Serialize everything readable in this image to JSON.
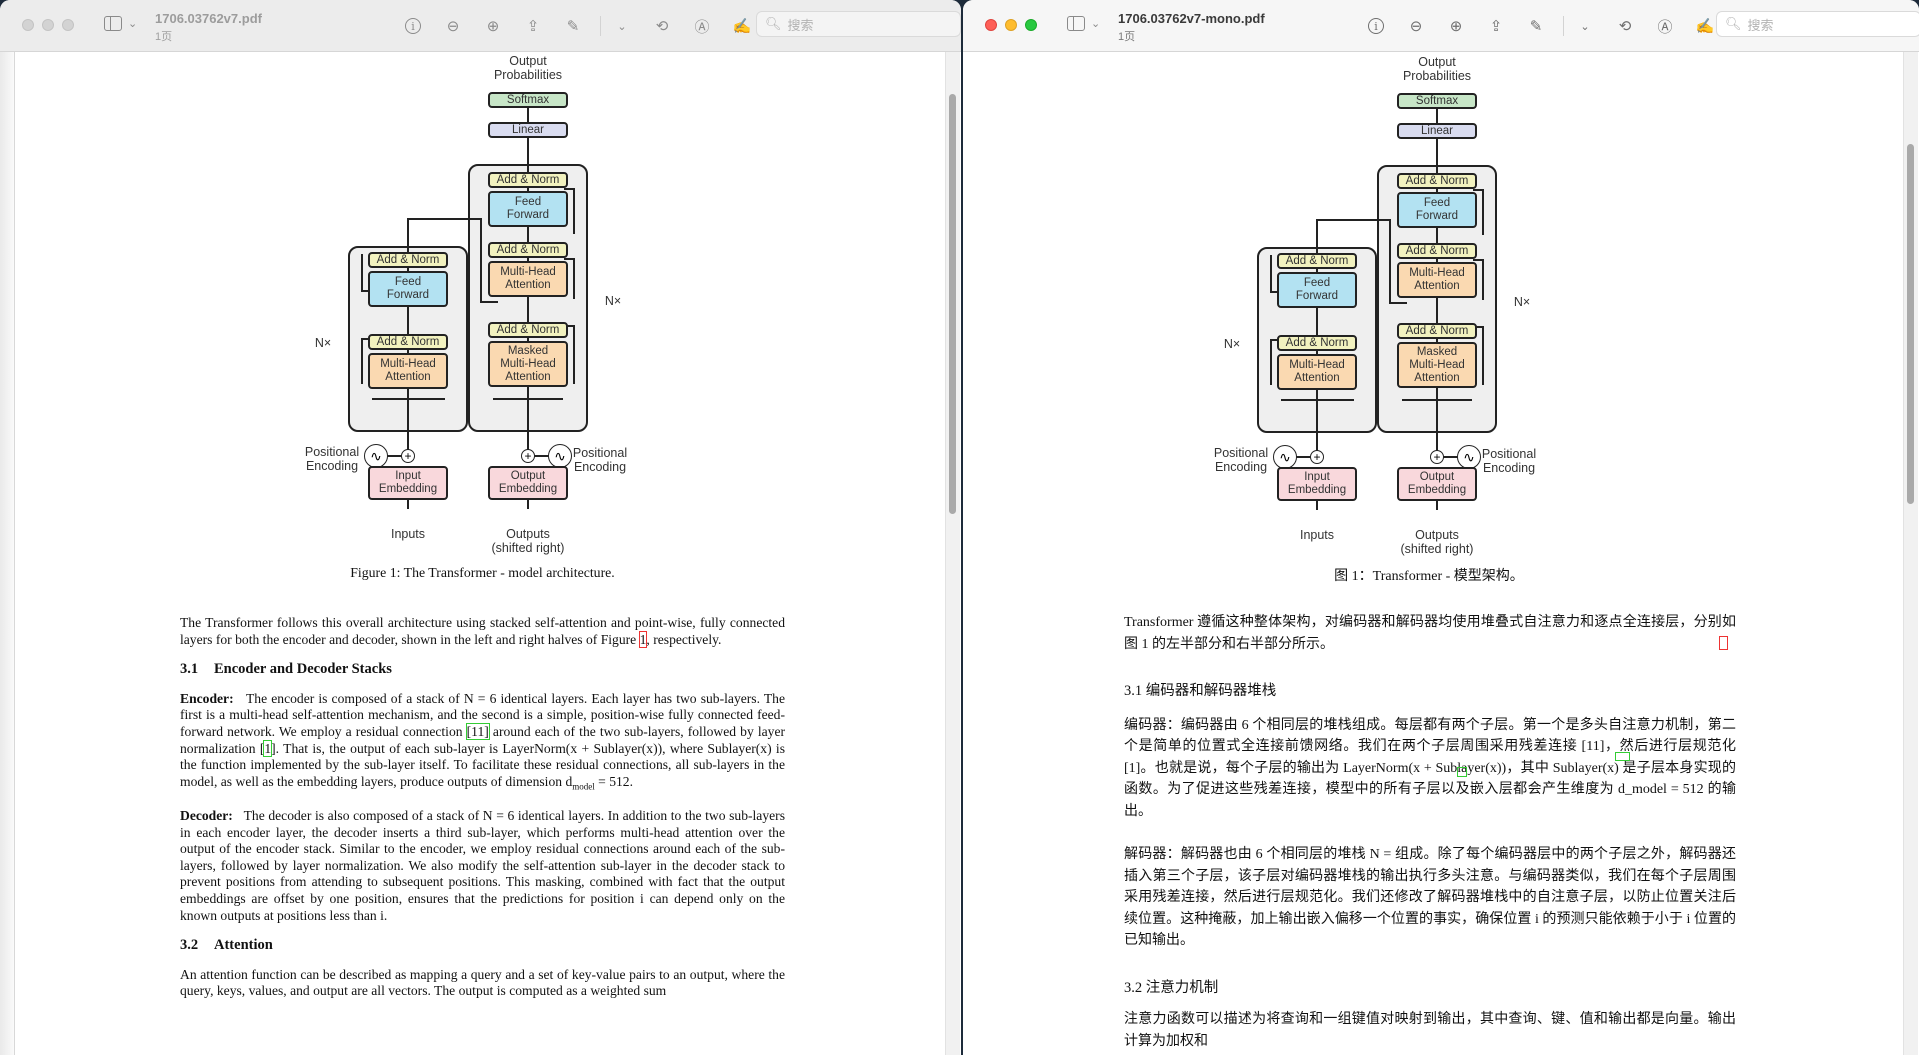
{
  "left_window": {
    "title": "1706.03762v7.pdf",
    "subtitle": "1页",
    "search_placeholder": "搜索",
    "diagram": {
      "output_label": "Output\nProbabilities",
      "softmax": "Softmax",
      "linear": "Linear",
      "add_norm": "Add & Norm",
      "feed_forward": "Feed\nForward",
      "multi_head": "Multi-Head\nAttention",
      "masked_multi_head": "Masked\nMulti-Head\nAttention",
      "nx": "N×",
      "pos_enc": "Positional\nEncoding",
      "input_emb": "Input\nEmbedding",
      "output_emb": "Output\nEmbedding",
      "inputs": "Inputs",
      "outputs": "Outputs\n(shifted right)"
    },
    "caption": "Figure 1: The Transformer - model architecture.",
    "intro": {
      "before": "The Transformer follows this overall architecture using stacked self-attention and point-wise, fully connected layers for both the encoder and decoder, shown in the left and right halves of Figure ",
      "ref": "1",
      "after": ", respectively."
    },
    "section_31": {
      "num": "3.1",
      "title": "Encoder and Decoder Stacks"
    },
    "encoder": {
      "label": "Encoder:",
      "p1": "The encoder is composed of a stack of N = 6 identical layers. Each layer has two sub-layers. The first is a multi-head self-attention mechanism, and the second is a simple, position-wise fully connected feed-forward network. We employ a residual connection ",
      "ref1": "[11]",
      "p2": " around each of the two sub-layers, followed by layer normalization [",
      "ref2": "1",
      "p3": "]. That is, the output of each sub-layer is LayerNorm(x + Sublayer(x)), where Sublayer(x) is the function implemented by the sub-layer itself. To facilitate these residual connections, all sub-layers in the model, as well as the embedding layers, produce outputs of dimension d",
      "sub": "model",
      "p4": " = 512."
    },
    "decoder": {
      "label": "Decoder:",
      "text": "The decoder is also composed of a stack of N = 6 identical layers. In addition to the two sub-layers in each encoder layer, the decoder inserts a third sub-layer, which performs multi-head attention over the output of the encoder stack. Similar to the encoder, we employ residual connections around each of the sub-layers, followed by layer normalization. We also modify the self-attention sub-layer in the decoder stack to prevent positions from attending to subsequent positions. This masking, combined with fact that the output embeddings are offset by one position, ensures that the predictions for position i can depend only on the known outputs at positions less than i."
    },
    "section_32": {
      "num": "3.2",
      "title": "Attention"
    },
    "attention": "An attention function can be described as mapping a query and a set of key-value pairs to an output, where the query, keys, values, and output are all vectors. The output is computed as a weighted sum"
  },
  "right_window": {
    "title": "1706.03762v7-mono.pdf",
    "subtitle": "1页",
    "search_placeholder": "搜索",
    "caption": "图 1：Transformer - 模型架构。",
    "intro": "Transformer 遵循这种整体架构，对编码器和解码器均使用堆叠式自注意力和逐点全连接层，分别如图 1 的左半部分和右半部分所示。",
    "section_31": "3.1 编码器和解码器堆栈",
    "encoder": "编码器：编码器由 6 个相同层的堆栈组成。每层都有两个子层。第一个是多头自注意力机制，第二个是简单的位置式全连接前馈网络。我们在两个子层周围采用残差连接 [11]，然后进行层规范化 [1]。也就是说，每个子层的输出为 LayerNorm(x + Sublayer(x))，其中 Sublayer(x) 是子层本身实现的函数。为了促进这些残差连接，模型中的所有子层以及嵌入层都会产生维度为 d_model = 512 的输出。",
    "decoder": "解码器：解码器也由 6 个相同层的堆栈 N = 组成。除了每个编码器层中的两个子层之外，解码器还插入第三个子层，该子层对编码器堆栈的输出执行多头注意。与编码器类似，我们在每个子层周围采用残差连接，然后进行层规范化。我们还修改了解码器堆栈中的自注意子层，以防止位置关注后续位置。这种掩蔽，加上输出嵌入偏移一个位置的事实，确保位置 i 的预测只能依赖于小于 i 位置的已知输出。",
    "section_32": "3.2 注意力机制",
    "attention": "注意力函数可以描述为将查询和一组键值对映射到输出，其中查询、键、值和输出都是向量。输出计算为加权和"
  },
  "toolbar_icons": [
    "info-icon",
    "zoom-out-icon",
    "zoom-in-icon",
    "share-icon",
    "highlight-pen-icon",
    "chevron-down-icon",
    "rotate-icon",
    "markup-icon",
    "sign-icon",
    "search-icon"
  ],
  "colors": {
    "add_norm": "#f2f2bf",
    "feed_forward": "#b3e2f2",
    "attention": "#fad9b1",
    "embedding": "#f9d8dc",
    "softmax": "#c7e6c7",
    "linear": "#d9dcf0"
  }
}
